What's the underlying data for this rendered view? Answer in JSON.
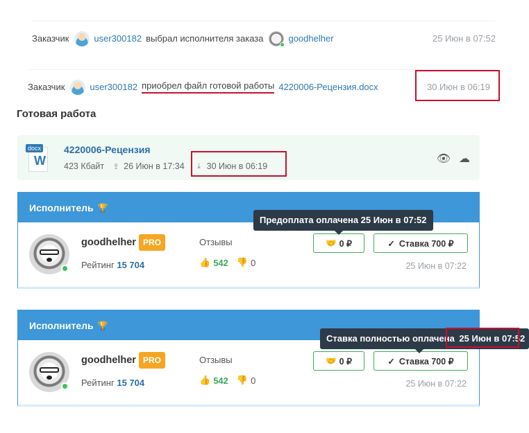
{
  "history": [
    {
      "role": "Заказчик",
      "user": "user300182",
      "action": "выбрал исполнителя заказа",
      "executor": "goodhelher",
      "date": "25 Июн в 07:52"
    },
    {
      "role": "Заказчик",
      "user": "user300182",
      "action": "приобрел файл готовой работы",
      "file_link": "4220006-Рецензия.docx",
      "date": "30 Июн в 06:19"
    }
  ],
  "ready_work": {
    "title": "Готовая работа",
    "file": {
      "ext": "docx",
      "icon_letter": "W",
      "name": "4220006-Рецензия",
      "size": "423 Кбайт",
      "uploaded": "26 Июн в 17:34",
      "downloaded": "30 Июн в 06:19"
    }
  },
  "executors": [
    {
      "header": "Исполнитель",
      "name": "goodhelher",
      "badge": "PRO",
      "rating_label": "Рейтинг",
      "rating_value": "15 704",
      "reviews_label": "Отзывы",
      "positive": "542",
      "negative": "0",
      "deposit_label": "0 ₽",
      "bid_label": "Ставка 700 ₽",
      "date": "25 Июн в 07:22",
      "tooltip": "Предоплата оплачена 25 Июн в 07:52"
    },
    {
      "header": "Исполнитель",
      "name": "goodhelher",
      "badge": "PRO",
      "rating_label": "Рейтинг",
      "rating_value": "15 704",
      "reviews_label": "Отзывы",
      "positive": "542",
      "negative": "0",
      "deposit_label": "0 ₽",
      "bid_label": "Ставка 700 ₽",
      "date": "25 Июн в 07:22",
      "tooltip_prefix": "Ставка полностью оплачена",
      "tooltip_date": "25 Июн в 07:52"
    }
  ],
  "colors": {
    "accent": "#3d97d8",
    "link": "#2d79b5",
    "success": "#3cad5a",
    "pro": "#f6a623",
    "highlight": "#c8102e",
    "tooltip_bg": "#2d3a48"
  }
}
